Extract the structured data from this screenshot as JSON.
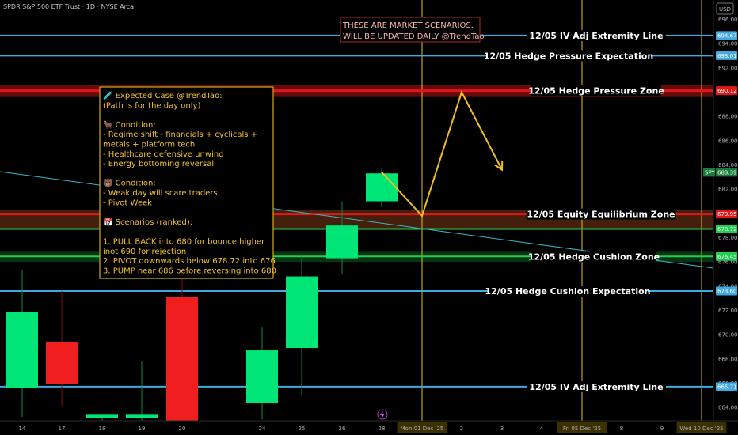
{
  "header": {
    "ticker_line": "SPDR S&P 500 ETF Trust · 1D · NYSE Arca",
    "currency_button": "USD"
  },
  "scenario_banner": {
    "line1": "THESE ARE MARKET SCENARIOS.",
    "line2": "WILL BE UPDATED DAILY @TrendTao"
  },
  "expected_case_box": {
    "lines": [
      "🧪 Expected Case @TrendTao:",
      "    (Path is for the day only)",
      "",
      "🐂 Condition:",
      "- Regime shift - financials + cyclicals +",
      "  metals + platform tech",
      "- Healthcare defensive unwind",
      "- Energy bottoming reversal",
      "",
      "🐻 Condition:",
      "- Weak day will scare traders",
      "- Pivot Week",
      "",
      "📅 Scenarios (ranked):",
      "",
      "1. PULL BACK into 680 for bounce higher",
      "    inot 690 for rejection",
      "2. PIVOT downwards below 678.72 into 676",
      "3. PUMP near 686 before reversing into 680"
    ]
  },
  "colors": {
    "up": "#00e676",
    "down": "#f01e1e",
    "blue_line": "#3fa9e0",
    "green_line": "#20d050",
    "red_zone": "#e01818",
    "gold": "#d8b020",
    "arrow": "#f0c020",
    "trend": "#3fb6c8"
  },
  "chart_data": {
    "type": "candlestick",
    "symbol": "SPY",
    "timeframe": "1D",
    "ylim": [
      662.9,
      697.6
    ],
    "y_ticks": [
      664,
      666,
      668,
      670,
      672,
      674,
      676,
      678,
      680,
      682,
      684,
      686,
      688,
      690,
      692,
      694,
      696
    ],
    "x_ticks": [
      "14",
      "17",
      "18",
      "19",
      "20",
      "24",
      "25",
      "26",
      "28",
      "Mon 01 Dec '25",
      "2",
      "3",
      "4",
      "Fri 05 Dec '25",
      "8",
      "9",
      "Wed 10 Dec '25"
    ],
    "candles": [
      {
        "date": "14",
        "open": 665.6,
        "high": 675.3,
        "low": 663.2,
        "close": 671.9
      },
      {
        "date": "17",
        "open": 669.4,
        "high": 673.6,
        "low": 664.1,
        "close": 665.9
      },
      {
        "date": "18",
        "open": 663.1,
        "high": 663.4,
        "low": 662.9,
        "close": 663.4
      },
      {
        "date": "19",
        "open": 663.1,
        "high": 667.8,
        "low": 662.9,
        "close": 663.4
      },
      {
        "date": "20",
        "open": 673.1,
        "high": 676.0,
        "low": 662.9,
        "close": 662.9
      },
      {
        "date": "24",
        "open": 664.4,
        "high": 670.6,
        "low": 663.0,
        "close": 668.7
      },
      {
        "date": "25",
        "open": 668.9,
        "high": 676.5,
        "low": 665.0,
        "close": 674.8
      },
      {
        "date": "26",
        "open": 676.3,
        "high": 681.0,
        "low": 675.0,
        "close": 679.0
      },
      {
        "date": "28",
        "open": 681.0,
        "high": 683.7,
        "low": 680.5,
        "close": 683.3
      }
    ],
    "levels": [
      {
        "name": "12/05 IV Adj Extremity Line",
        "price": 694.67,
        "color": "blue"
      },
      {
        "name": "12/05 Hedge Pressure Expectation",
        "price": 693.01,
        "color": "blue"
      },
      {
        "name": "12/05 Hedge Pressure Zone",
        "price": 690.12,
        "color": "red"
      },
      {
        "name": "12/05 Equity Equilibrium Zone",
        "price": 679.95,
        "color": "red"
      },
      {
        "name": "",
        "price": 678.72,
        "color": "green"
      },
      {
        "name": "12/05 Hedge Cushion Zone",
        "price": 676.45,
        "color": "green"
      },
      {
        "name": "12/05 Hedge Cushion Expectation",
        "price": 673.6,
        "color": "blue"
      },
      {
        "name": "12/05 IV Adj Extremity Line",
        "price": 665.71,
        "color": "blue"
      }
    ],
    "price_tags": [
      "694.67",
      "693.01",
      "690.12",
      "679.95",
      "678.72",
      "676.45",
      "673.60",
      "665.71",
      "683.39"
    ],
    "last_price_label": "SPY",
    "last_price": 683.39,
    "scenario_path": [
      {
        "x": "28",
        "y": 683.4
      },
      {
        "x": "Mon 01 Dec '25",
        "y": 679.8
      },
      {
        "x": "2",
        "y": 690.0
      },
      {
        "x": "3",
        "y": 683.6
      }
    ],
    "vertical_markers": [
      "Mon 01 Dec '25",
      "Fri 05 Dec '25",
      "Wed 10 Dec '25"
    ]
  }
}
